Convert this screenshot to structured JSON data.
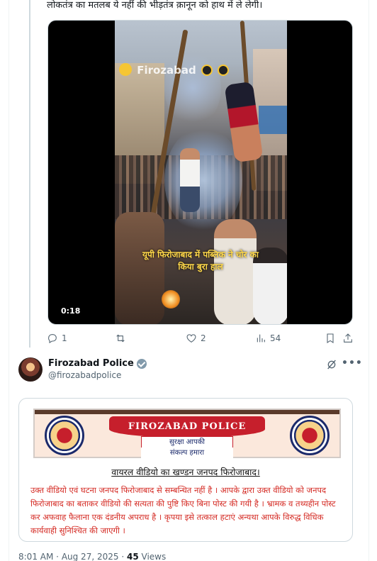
{
  "first_tweet": {
    "text_tail": "लोकतंत्र का मतलब ये नहीं की भीड़तंत्र क़ानून को हाथ में ले लेगी।",
    "video": {
      "watermark": "Firozabad",
      "caption": "यूपी फिरोजाबाद में पब्लिक ने चोर का किया बुरा हाल",
      "duration": "0:18"
    },
    "actions": {
      "replies": "1",
      "reposts": "",
      "likes": "2",
      "views": "54"
    }
  },
  "second_tweet": {
    "display_name": "Firozabad Police",
    "handle": "@firozabadpolice",
    "notice": {
      "banner_title": "FIROZABAD POLICE",
      "banner_line1": "सुरक्षा आपकी",
      "banner_line2": "संकल्प हमारा",
      "heading": "वायरल वीडियो का खण्डन जनपद फिरोजाबाद।",
      "body": "उक्त वीडियो एवं घटना जनपद फिरोजाबाद से सम्बन्धित नहीं है । आपके द्वारा उक्त वीडियो को जनपद फिरोजाबाद का बताकर वीडियो की सत्यता की पुष्टि किए बिना पोस्ट की गयी है । भ्रामक व तथ्यहीन पोस्ट कर अफवाह फैलाना एक दंडनीय अपराध है । कृपया इसे तत्काल हटाएं अन्यथा आपके विरुद्ध विधिक कार्यवाही सुनिश्चित की जाएगी ।"
    },
    "meta": {
      "time": "8:01 AM",
      "date": "Aug 27, 2025",
      "separator": "·",
      "views_count": "45",
      "views_label": "Views"
    }
  },
  "icons": {
    "reply": "reply-icon",
    "repost": "repost-icon",
    "like": "heart-icon",
    "views": "views-icon",
    "bookmark": "bookmark-icon",
    "share": "share-icon",
    "verified": "verified-badge-icon",
    "grok": "grok-icon",
    "more": "more-icon"
  },
  "colors": {
    "text_secondary": "#536471",
    "border": "#cfd9de",
    "notice_red": "#d42a23",
    "banner_red": "#c61f2c",
    "banner_navy": "#1b2a6b"
  }
}
